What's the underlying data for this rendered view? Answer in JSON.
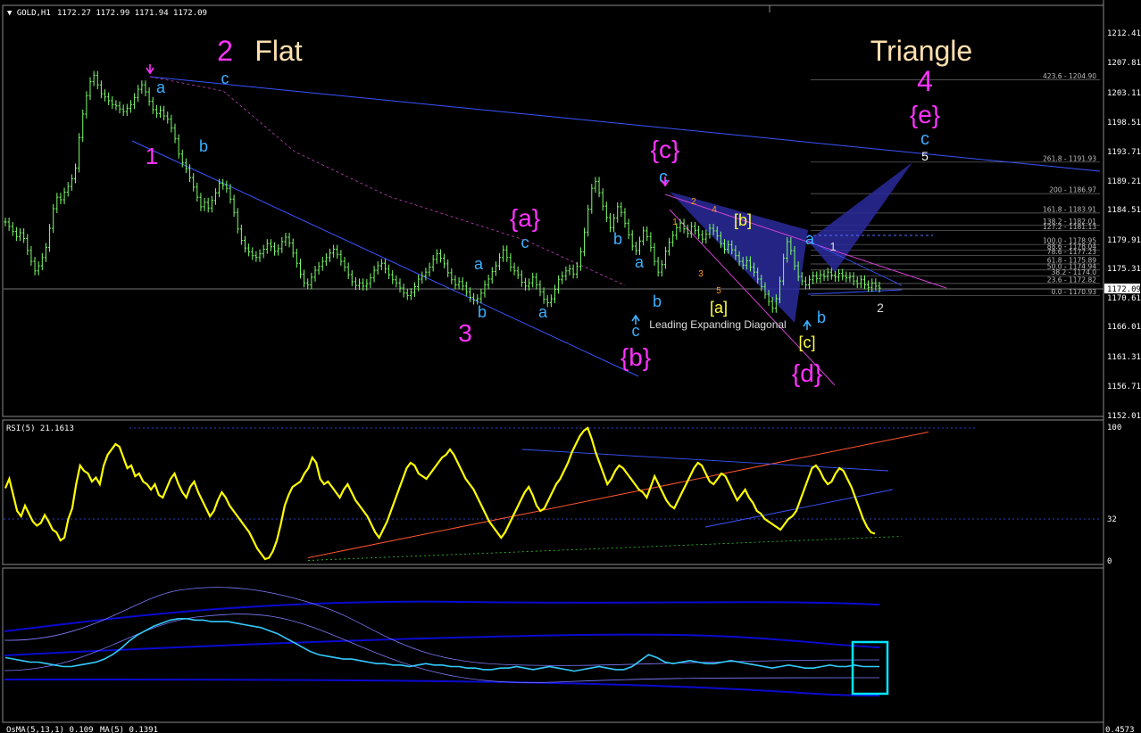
{
  "header": {
    "symbol_title": "GOLD,H1",
    "ohlc": "1172.27 1172.99 1171.94 1172.09",
    "rsi_label": "RSI(5) 21.1613",
    "osma_label": "OsMA(5,13,1) 0.109",
    "ma_label": "MA(5) 0.1391"
  },
  "colors": {
    "background": "#000000",
    "grid": "#1c1c1c",
    "candle": "#7cff6a",
    "channel": "#3a55ff",
    "wave_magenta": "#ff33ff",
    "wave_cyan": "#3ab0ff",
    "wave_cream": "#ffe0b0",
    "rsi_line": "#ffff00",
    "rsi_trend": "#ff5530",
    "lower_line": "#33ccff",
    "box": "#00e5ff"
  },
  "price_axis": {
    "ticks": [
      "1212.41",
      "1207.81",
      "1203.11",
      "1198.51",
      "1193.71",
      "1189.21",
      "1184.51",
      "1179.91",
      "1175.31",
      "1170.61",
      "1166.01",
      "1161.31",
      "1156.71",
      "1152.01"
    ],
    "current_price": "1172.09"
  },
  "rsi_axis": {
    "ticks": [
      "100",
      "32",
      "0"
    ]
  },
  "lower_axis": {
    "ticks": [
      "0.4573"
    ]
  },
  "fib_levels": [
    {
      "label": "423.6 - 1204.90",
      "price": 1204.9
    },
    {
      "label": "261.8 - 1191.93",
      "price": 1191.93
    },
    {
      "label": "200 - 1186.97",
      "price": 1186.97
    },
    {
      "label": "161.8 - 1183.91",
      "price": 1183.91
    },
    {
      "label": "138.2 - 1182.01",
      "price": 1182.01
    },
    {
      "label": "127.2 - 1181.13",
      "price": 1181.13
    },
    {
      "label": "100.0 - 1178.95",
      "price": 1178.95
    },
    {
      "label": "88.6 - 1178.04",
      "price": 1178.04
    },
    {
      "label": "78.6 - 1177.23",
      "price": 1177.23
    },
    {
      "label": "61.8 - 1175.89",
      "price": 1175.89
    },
    {
      "label": "50.0 - 1174.94",
      "price": 1174.94
    },
    {
      "label": "38.2 - 1174.0",
      "price": 1174.0
    },
    {
      "label": "23.6 - 1172.82",
      "price": 1172.82
    },
    {
      "label": "0.0 - 1170.93",
      "price": 1170.93
    }
  ],
  "wave_labels": {
    "big_2": "2",
    "flat": "Flat",
    "triangle": "Triangle",
    "big_4": "4",
    "e_brace": "{e}",
    "c_top": "c",
    "five": "5",
    "a1": "a",
    "c1": "c",
    "one": "1",
    "b1": "b",
    "a_brace": "{a}",
    "c2": "c",
    "a2": "a",
    "b2": "b",
    "three": "3",
    "a3": "a",
    "b3": "b",
    "a4": "a",
    "c3": "c",
    "b_brace": "{b}",
    "b4": "b",
    "c_brace": "{c}",
    "c4": "c",
    "sub1": "1",
    "sub2": "2",
    "sub3": "3",
    "sub4": "4",
    "sub5": "5",
    "b_square": "[b]",
    "a_square": "[a]",
    "diagonal": "Leading Expanding Diagonal",
    "c_square": "[c]",
    "d_brace": "{d}",
    "a5": "a",
    "one_small": "1",
    "b5": "b",
    "two_small": "2"
  },
  "chart_data": {
    "type": "line",
    "title": "GOLD,H1",
    "ylim": [
      1152.01,
      1212.41
    ],
    "price_series": [
      1182.5,
      1181.8,
      1181.0,
      1180.2,
      1180.8,
      1179.9,
      1178.0,
      1176.3,
      1174.8,
      1175.6,
      1176.9,
      1178.5,
      1181.5,
      1184.6,
      1186.4,
      1186.0,
      1187.2,
      1188.1,
      1189.3,
      1191.0,
      1195.8,
      1199.5,
      1202.4,
      1204.6,
      1205.6,
      1204.1,
      1202.7,
      1202.2,
      1201.6,
      1201.0,
      1200.8,
      1200.3,
      1199.9,
      1200.4,
      1201.0,
      1202.1,
      1203.4,
      1204.1,
      1203.0,
      1201.5,
      1200.2,
      1199.6,
      1200.1,
      1199.2,
      1198.7,
      1197.3,
      1195.6,
      1193.2,
      1191.8,
      1190.9,
      1189.5,
      1188.0,
      1186.4,
      1184.9,
      1185.6,
      1184.7,
      1185.9,
      1187.1,
      1188.6,
      1188.3,
      1187.8,
      1186.1,
      1184.0,
      1181.4,
      1179.6,
      1178.4,
      1177.8,
      1177.2,
      1176.9,
      1177.5,
      1178.2,
      1179.1,
      1178.6,
      1177.9,
      1178.3,
      1179.4,
      1180.1,
      1179.2,
      1177.6,
      1176.0,
      1174.3,
      1172.9,
      1172.6,
      1173.8,
      1174.9,
      1175.5,
      1176.3,
      1176.9,
      1177.6,
      1178.2,
      1177.4,
      1176.3,
      1175.4,
      1174.2,
      1173.1,
      1172.5,
      1172.9,
      1172.4,
      1172.8,
      1173.7,
      1174.9,
      1175.6,
      1176.0,
      1175.1,
      1174.2,
      1173.4,
      1172.9,
      1172.1,
      1171.3,
      1170.9,
      1171.4,
      1172.3,
      1173.5,
      1174.0,
      1174.6,
      1175.4,
      1176.6,
      1177.5,
      1176.8,
      1175.9,
      1174.5,
      1173.4,
      1172.6,
      1173.1,
      1172.4,
      1171.5,
      1170.6,
      1170.2,
      1170.4,
      1171.3,
      1172.6,
      1173.5,
      1174.7,
      1175.6,
      1176.9,
      1178.1,
      1176.9,
      1175.4,
      1174.8,
      1174.2,
      1173.0,
      1172.4,
      1172.9,
      1173.8,
      1172.6,
      1171.5,
      1170.3,
      1169.8,
      1170.4,
      1171.9,
      1173.4,
      1174.0,
      1174.8,
      1175.1,
      1174.3,
      1175.5,
      1177.8,
      1180.9,
      1184.5,
      1187.8,
      1188.9,
      1187.1,
      1185.0,
      1183.2,
      1181.6,
      1183.1,
      1184.9,
      1184.0,
      1182.3,
      1180.5,
      1178.7,
      1178.0,
      1179.5,
      1181.1,
      1180.2,
      1178.5,
      1176.3,
      1174.6,
      1175.8,
      1177.9,
      1179.3,
      1180.4,
      1181.6,
      1182.3,
      1181.4,
      1180.7,
      1181.8,
      1181.2,
      1180.5,
      1179.8,
      1180.6,
      1181.5,
      1181.1,
      1180.3,
      1179.1,
      1178.2,
      1178.9,
      1178.1,
      1177.2,
      1176.3,
      1175.7,
      1176.4,
      1175.4,
      1174.6,
      1173.5,
      1172.3,
      1171.1,
      1170.0,
      1168.9,
      1170.4,
      1173.2,
      1176.8,
      1179.4,
      1178.0,
      1175.6,
      1173.9,
      1173.2,
      1172.6,
      1173.4,
      1174.0,
      1173.6,
      1174.2,
      1173.9,
      1174.6,
      1174.1,
      1173.8,
      1174.4,
      1174.0,
      1173.7,
      1173.9,
      1173.2,
      1172.8,
      1173.4,
      1172.6,
      1172.2,
      1172.9,
      1172.4,
      1172.09
    ],
    "rsi_series": [
      55,
      62,
      50,
      38,
      34,
      42,
      36,
      30,
      27,
      29,
      35,
      30,
      24,
      22,
      16,
      18,
      32,
      40,
      58,
      72,
      68,
      66,
      60,
      63,
      58,
      72,
      80,
      84,
      88,
      86,
      78,
      70,
      72,
      64,
      66,
      60,
      58,
      54,
      58,
      50,
      48,
      55,
      62,
      66,
      58,
      52,
      48,
      56,
      60,
      52,
      46,
      40,
      34,
      38,
      46,
      52,
      48,
      42,
      38,
      34,
      30,
      26,
      22,
      16,
      10,
      6,
      2,
      3,
      8,
      16,
      28,
      42,
      50,
      56,
      58,
      60,
      66,
      70,
      78,
      74,
      62,
      58,
      60,
      56,
      52,
      48,
      54,
      58,
      52,
      46,
      42,
      38,
      34,
      28,
      22,
      18,
      24,
      30,
      38,
      46,
      54,
      62,
      70,
      74,
      72,
      66,
      64,
      62,
      66,
      70,
      74,
      78,
      80,
      84,
      80,
      74,
      68,
      62,
      58,
      54,
      48,
      42,
      36,
      30,
      26,
      22,
      18,
      22,
      28,
      34,
      40,
      46,
      52,
      56,
      50,
      42,
      38,
      40,
      46,
      52,
      58,
      62,
      68,
      74,
      82,
      88,
      94,
      98,
      100,
      92,
      82,
      74,
      66,
      58,
      62,
      68,
      72,
      70,
      66,
      62,
      58,
      54,
      52,
      48,
      56,
      64,
      58,
      52,
      46,
      42,
      40,
      46,
      52,
      58,
      64,
      70,
      74,
      72,
      66,
      60,
      58,
      62,
      66,
      64,
      58,
      52,
      46,
      50,
      54,
      48,
      44,
      38,
      36,
      32,
      30,
      28,
      26,
      24,
      28,
      32,
      34,
      38,
      46,
      54,
      62,
      70,
      72,
      68,
      62,
      58,
      60,
      66,
      70,
      68,
      62,
      56,
      48,
      40,
      32,
      26,
      22,
      21
    ],
    "lower_series": [
      0.42,
      0.41,
      0.4,
      0.39,
      0.39,
      0.38,
      0.37,
      0.36,
      0.36,
      0.37,
      0.38,
      0.39,
      0.41,
      0.44,
      0.48,
      0.53,
      0.57,
      0.6,
      0.63,
      0.65,
      0.67,
      0.68,
      0.68,
      0.67,
      0.67,
      0.66,
      0.66,
      0.66,
      0.65,
      0.64,
      0.63,
      0.62,
      0.6,
      0.58,
      0.55,
      0.52,
      0.49,
      0.46,
      0.44,
      0.43,
      0.42,
      0.41,
      0.41,
      0.4,
      0.39,
      0.38,
      0.38,
      0.37,
      0.37,
      0.36,
      0.37,
      0.38,
      0.37,
      0.37,
      0.36,
      0.36,
      0.35,
      0.35,
      0.34,
      0.34,
      0.35,
      0.35,
      0.36,
      0.35,
      0.34,
      0.35,
      0.36,
      0.35,
      0.34,
      0.33,
      0.34,
      0.35,
      0.36,
      0.35,
      0.34,
      0.34,
      0.36,
      0.4,
      0.44,
      0.42,
      0.39,
      0.38,
      0.39,
      0.4,
      0.39,
      0.38,
      0.38,
      0.39,
      0.4,
      0.39,
      0.38,
      0.37,
      0.36,
      0.35,
      0.36,
      0.37,
      0.36,
      0.35,
      0.35,
      0.36,
      0.37,
      0.36,
      0.36,
      0.37,
      0.36,
      0.36,
      0.36
    ]
  }
}
